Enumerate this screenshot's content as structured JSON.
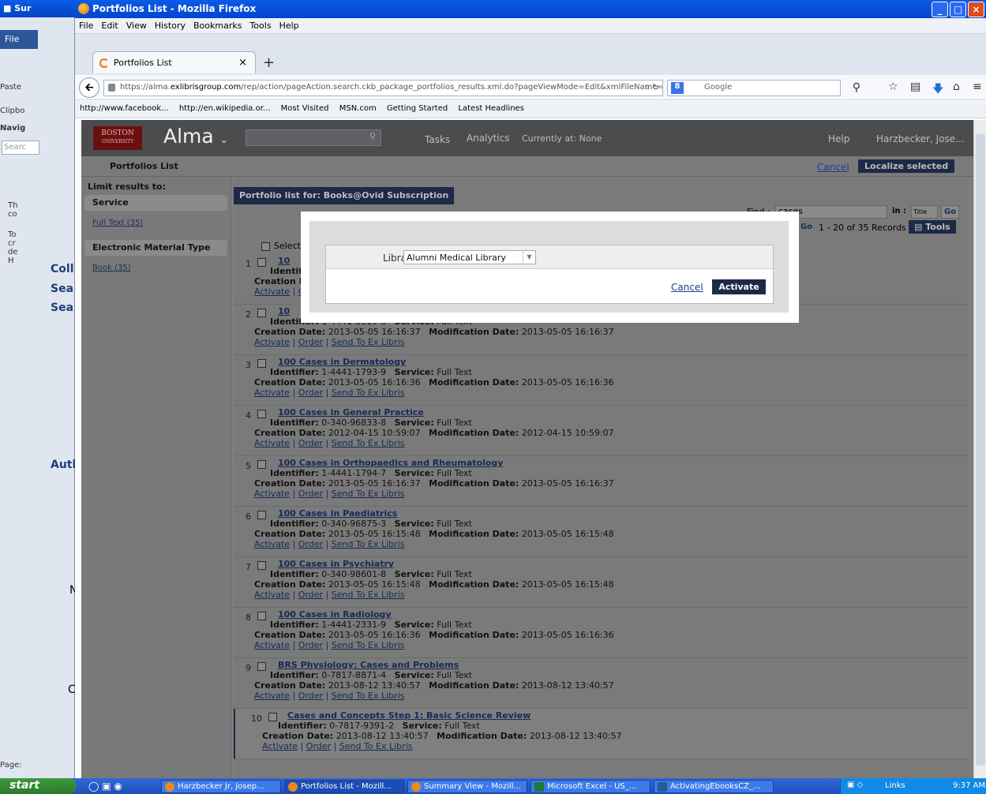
{
  "word": {
    "title": "Sur",
    "file_tab": "File",
    "side_texts": [
      "Paste",
      "Clipbo",
      "Navig",
      "Searc",
      "Th",
      "co",
      "To",
      "cr",
      "de",
      "H",
      "Page:"
    ],
    "doc_texts": [
      "Coll",
      "Sea",
      "Sea",
      "Autl",
      "N",
      "C"
    ]
  },
  "firefox": {
    "title": "Portfolios List - Mozilla Firefox",
    "menu": [
      "File",
      "Edit",
      "View",
      "History",
      "Bookmarks",
      "Tools",
      "Help"
    ],
    "tab_title": "Portfolios List",
    "url_prefix": "https://alma.",
    "url_domain": "exlibrisgroup.com",
    "url_rest": "/rep/action/pageAction.search.ckb_package_portfolios_results.xml.do?pageViewMode=Edit&xmlFileName=",
    "search_placeholder": "Google",
    "bookmarks": [
      "http://www.facebook...",
      "http://en.wikipedia.or...",
      "Most Visited",
      "MSN.com",
      "Getting Started",
      "Latest Headlines"
    ]
  },
  "alma": {
    "university_line1": "BOSTON",
    "university_line2": "UNIVERSITY",
    "logo": "Alma",
    "tasks": "Tasks",
    "analytics": "Analytics",
    "currently_at": "Currently at:",
    "currently_at_value": "None",
    "help": "Help",
    "user": "Harzbecker, Jose...",
    "page_title": "Portfolios List",
    "cancel": "Cancel",
    "localize_selected": "Localize selected"
  },
  "sidebar": {
    "title": "Limit results to:",
    "groups": [
      {
        "header": "Service",
        "link": "Full Text (35)"
      },
      {
        "header": "Electronic Material Type",
        "link": "Book (35)"
      }
    ]
  },
  "results": {
    "portfolio_label": "Portfolio list for: Books@Ovid Subscription",
    "find_label": "Find :",
    "find_value": "cases",
    "in_label": "in :",
    "in_value": "Title",
    "go": "Go",
    "go2": "Go",
    "records": "1 - 20 of 35 Records",
    "tools": "Tools",
    "select_label": "Select",
    "lbl_identifier": "Identifier:",
    "lbl_service": "Service:",
    "lbl_creation": "Creation Date:",
    "lbl_modification": "Modification Date:",
    "action_activate": "Activate",
    "action_order": "Order",
    "action_send": "Send To Ex Libris",
    "items": [
      {
        "n": "1",
        "title": "10",
        "identifier": "",
        "service": "",
        "created": "",
        "modified": ""
      },
      {
        "n": "2",
        "title": "10",
        "identifier": "1-4441-3519-8",
        "service": "Full Text",
        "created": "2013-05-05 16:16:37",
        "modified": "2013-05-05 16:16:37"
      },
      {
        "n": "3",
        "title": "100 Cases in Dermatology",
        "identifier": "1-4441-1793-9",
        "service": "Full Text",
        "created": "2013-05-05 16:16:36",
        "modified": "2013-05-05 16:16:36"
      },
      {
        "n": "4",
        "title": "100 Cases in General Practice",
        "identifier": "0-340-96833-8",
        "service": "Full Text",
        "created": "2012-04-15 10:59:07",
        "modified": "2012-04-15 10:59:07"
      },
      {
        "n": "5",
        "title": "100 Cases in Orthopaedics and Rheumatology",
        "identifier": "1-4441-1794-7",
        "service": "Full Text",
        "created": "2013-05-05 16:16:37",
        "modified": "2013-05-05 16:16:37"
      },
      {
        "n": "6",
        "title": "100 Cases in Paediatrics",
        "identifier": "0-340-96875-3",
        "service": "Full Text",
        "created": "2013-05-05 16:15:48",
        "modified": "2013-05-05 16:15:48"
      },
      {
        "n": "7",
        "title": "100 Cases in Psychiatry",
        "identifier": "0-340-98601-8",
        "service": "Full Text",
        "created": "2013-05-05 16:15:48",
        "modified": "2013-05-05 16:15:48"
      },
      {
        "n": "8",
        "title": "100 Cases in Radiology",
        "identifier": "1-4441-2331-9",
        "service": "Full Text",
        "created": "2013-05-05 16:16:36",
        "modified": "2013-05-05 16:16:36"
      },
      {
        "n": "9",
        "title": "BRS Physiology: Cases and Problems",
        "identifier": "0-7817-8871-4",
        "service": "Full Text",
        "created": "2013-08-12 13:40:57",
        "modified": "2013-08-12 13:40:57"
      },
      {
        "n": "10",
        "title": "Cases and Concepts Step 1: Basic Science Review",
        "identifier": "0-7817-9391-2",
        "service": "Full Text",
        "created": "2013-08-12 13:40:57",
        "modified": "2013-08-12 13:40:57"
      }
    ]
  },
  "dialog": {
    "library_label": "Library",
    "library_value": "Alumni Medical Library",
    "cancel": "Cancel",
    "activate": "Activate"
  },
  "taskbar": {
    "start": "start",
    "tasks": [
      "Harzbecker Jr, Josep...",
      "Portfolios List - Mozill...",
      "Summary View - Mozill...",
      "Microsoft Excel - US_...",
      "ActivatingEbooksCZ_..."
    ],
    "links": "Links",
    "time": "9:37 AM"
  }
}
